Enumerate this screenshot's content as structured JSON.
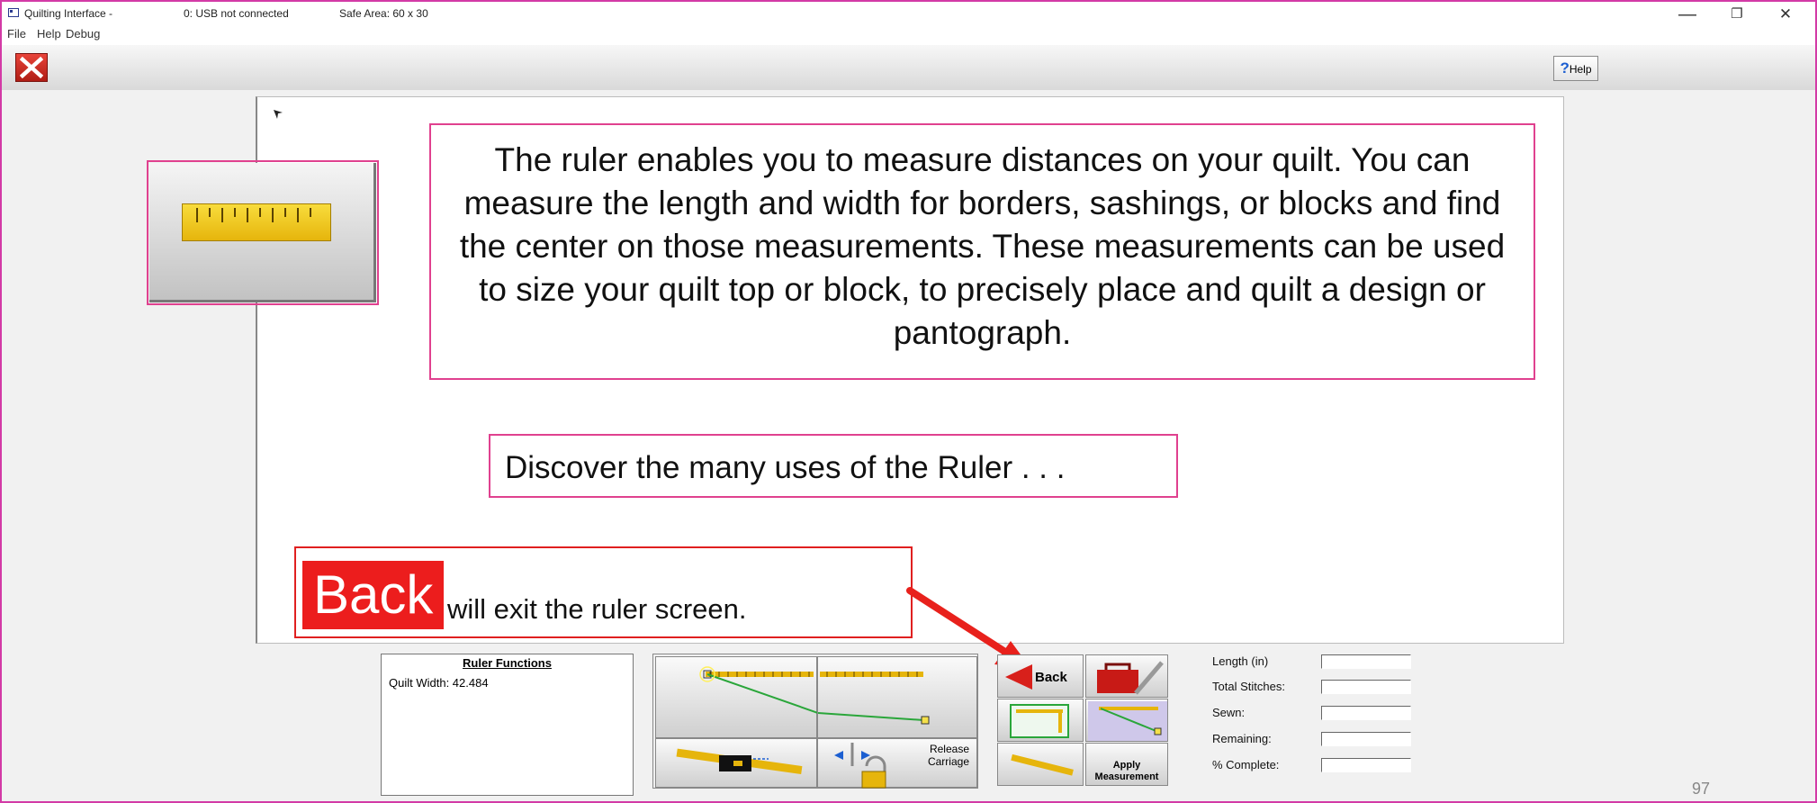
{
  "titlebar": {
    "app_title": "Quilting Interface -",
    "usb_status": "0: USB not connected",
    "safe_area": "Safe Area:  60 x 30",
    "controls": {
      "minimize": "—",
      "restore": "❐",
      "close": "✕"
    }
  },
  "menu": {
    "items": [
      "File",
      "Help",
      "Debug"
    ]
  },
  "toolbar": {
    "help_label": "Help",
    "help_icon": "?"
  },
  "callouts": {
    "main": "The ruler enables you to measure distances on your quilt. You can measure the length and width for borders, sashings, or blocks and find the center on those measurements. These measurements can be used to size your quilt top or block, to precisely place and quilt a design or pantograph.",
    "discover": "Discover the many uses of the Ruler . . .",
    "back_badge": "Back",
    "back_text": "will exit the ruler screen."
  },
  "ruler_functions": {
    "title": "Ruler Functions",
    "quilt_width": "Quilt Width: 42.484"
  },
  "tools": {
    "release": "Release",
    "carriage": "Carriage",
    "back": "Back",
    "apply": "Apply",
    "measurement": "Measurement"
  },
  "stats": {
    "labels": [
      "Length (in)",
      "Total Stitches:",
      "Sewn:",
      "Remaining:",
      "% Complete:"
    ]
  },
  "slide_number": "97",
  "colors": {
    "callout_border": "#e0418f",
    "back_red": "#ec1d1d",
    "arrow_red": "#e8211c",
    "ruler_yellow": "#f2c81e"
  }
}
